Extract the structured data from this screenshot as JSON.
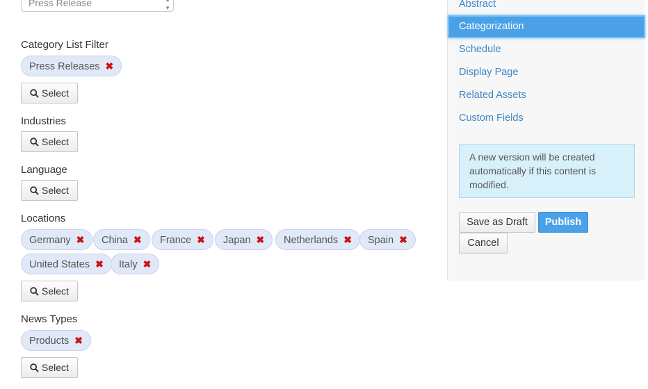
{
  "content_type": {
    "value": "Press Release"
  },
  "filters": [
    {
      "label": "Category List Filter",
      "tags": [
        "Press Releases"
      ],
      "button_label": "Select"
    },
    {
      "label": "Industries",
      "tags": [],
      "button_label": "Select"
    },
    {
      "label": "Language",
      "tags": [],
      "button_label": "Select"
    },
    {
      "label": "Locations",
      "tags": [
        "Germany",
        "China",
        "France",
        "Japan",
        "Netherlands",
        "Spain",
        "United States",
        "Italy"
      ],
      "button_label": "Select"
    },
    {
      "label": "News Types",
      "tags": [
        "Products"
      ],
      "button_label": "Select"
    }
  ],
  "sidebar": {
    "nav": [
      {
        "label": "Abstract",
        "active": false
      },
      {
        "label": "Categorization",
        "active": true
      },
      {
        "label": "Schedule",
        "active": false
      },
      {
        "label": "Display Page",
        "active": false
      },
      {
        "label": "Related Assets",
        "active": false
      },
      {
        "label": "Custom Fields",
        "active": false
      }
    ],
    "info_text": "A new version will be created automatically if this content is modified.",
    "save_draft_label": "Save as Draft",
    "publish_label": "Publish",
    "cancel_label": "Cancel"
  },
  "icons": {
    "remove": "close-icon",
    "search": "search-icon",
    "caret": "caret-icon"
  },
  "colors": {
    "link": "#3c86c6",
    "active_nav": "#4aa1e8",
    "tag_bg": "#e1e8f7",
    "remove": "#cc1111",
    "info_bg": "#d8f0f9",
    "primary": "#4aa1e8"
  }
}
